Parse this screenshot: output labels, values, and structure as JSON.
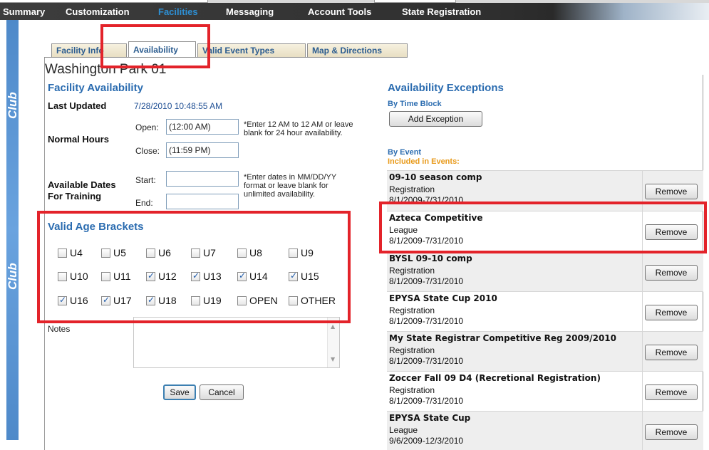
{
  "nav": {
    "items": [
      {
        "label": "Summary"
      },
      {
        "label": "Customization"
      },
      {
        "label": "Facilities"
      },
      {
        "label": "Messaging"
      },
      {
        "label": "Account Tools"
      },
      {
        "label": "State Registration"
      }
    ],
    "active": "Facilities"
  },
  "sidebar_text": "Club",
  "tabs": [
    {
      "label": "Facility Info"
    },
    {
      "label": "Availability"
    },
    {
      "label": "Valid Event Types"
    },
    {
      "label": "Map & Directions"
    }
  ],
  "active_tab": "Availability",
  "facility": {
    "name": "Washington Park 01",
    "section_title": "Facility Availability",
    "last_updated_label": "Last Updated",
    "last_updated_value": "7/28/2010 10:48:55 AM",
    "normal_hours_label": "Normal Hours",
    "open_label": "Open:",
    "open_value": "(12:00 AM)",
    "close_label": "Close:",
    "close_value": "(11:59 PM)",
    "hours_note": "*Enter 12 AM to 12 AM or leave blank for 24 hour availability.",
    "dates_label": "Available Dates For Training",
    "start_label": "Start:",
    "start_value": "",
    "end_label": "End:",
    "end_value": "",
    "dates_note": "*Enter dates in MM/DD/YY format or leave blank for unlimited availability.",
    "age_title": "Valid Age Brackets",
    "age_brackets": [
      {
        "label": "U4",
        "checked": false
      },
      {
        "label": "U5",
        "checked": false
      },
      {
        "label": "U6",
        "checked": false
      },
      {
        "label": "U7",
        "checked": false
      },
      {
        "label": "U8",
        "checked": false
      },
      {
        "label": "U9",
        "checked": false
      },
      {
        "label": "U10",
        "checked": false
      },
      {
        "label": "U11",
        "checked": false
      },
      {
        "label": "U12",
        "checked": true
      },
      {
        "label": "U13",
        "checked": true
      },
      {
        "label": "U14",
        "checked": true
      },
      {
        "label": "U15",
        "checked": true
      },
      {
        "label": "U16",
        "checked": true
      },
      {
        "label": "U17",
        "checked": true
      },
      {
        "label": "U18",
        "checked": true
      },
      {
        "label": "U19",
        "checked": false
      },
      {
        "label": "OPEN",
        "checked": false
      },
      {
        "label": "OTHER",
        "checked": false
      }
    ],
    "notes_label": "Notes",
    "save_label": "Save",
    "cancel_label": "Cancel"
  },
  "exceptions": {
    "title": "Availability Exceptions",
    "by_time_block": "By Time Block",
    "add_button": "Add Exception",
    "by_event": "By Event",
    "included": "Included in Events:",
    "remove_label": "Remove",
    "events": [
      {
        "name": "09-10 season comp",
        "type": "Registration",
        "dates": "8/1/2009-7/31/2010"
      },
      {
        "name": "Azteca Competitive",
        "type": "League",
        "dates": "8/1/2009-7/31/2010"
      },
      {
        "name": "BYSL 09-10 comp",
        "type": "Registration",
        "dates": "8/1/2009-7/31/2010"
      },
      {
        "name": "EPYSA State Cup 2010",
        "type": "Registration",
        "dates": "8/1/2009-7/31/2010"
      },
      {
        "name": "My State Registrar Competitive Reg 2009/2010",
        "type": "Registration",
        "dates": "8/1/2009-7/31/2010"
      },
      {
        "name": "Zoccer Fall 09 D4 (Recretional Registration)",
        "type": "Registration",
        "dates": "8/1/2009-7/31/2010"
      },
      {
        "name": "EPYSA State Cup",
        "type": "League",
        "dates": "9/6/2009-12/3/2010"
      }
    ]
  },
  "colors": {
    "highlight": "#e3232a",
    "link_blue": "#2b6cb0",
    "nav_active": "#2e8fd3",
    "included_orange": "#e89a1a"
  }
}
